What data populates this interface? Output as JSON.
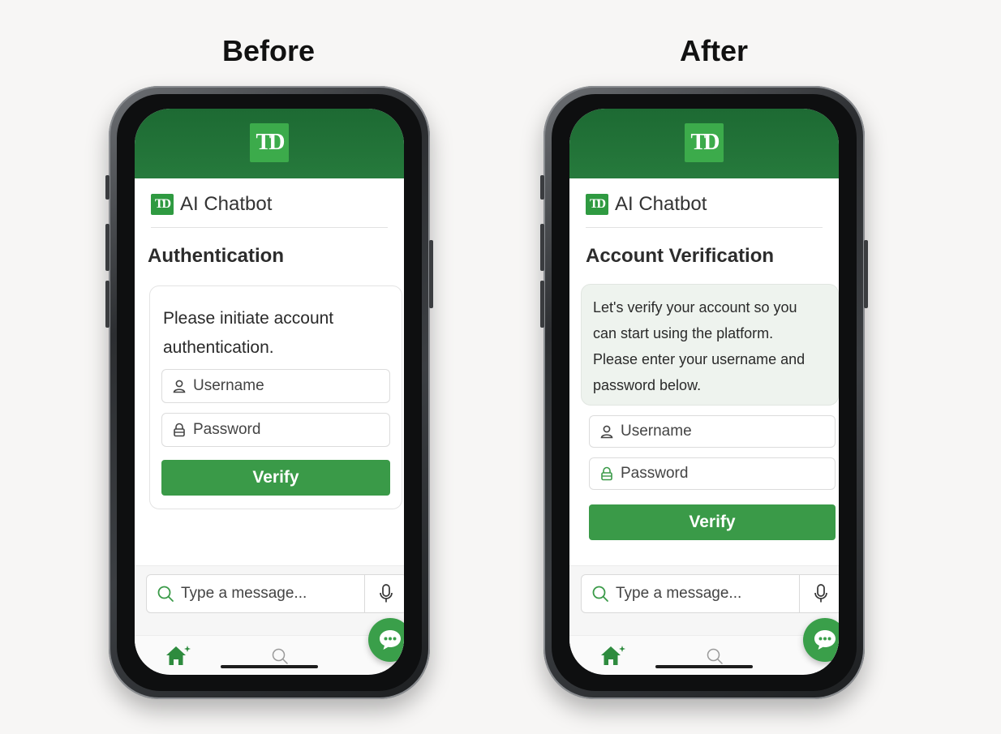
{
  "panels": [
    {
      "label": "Before",
      "header_logo": "TD",
      "brand_logo": "TD",
      "brand_name": "AI Chatbot",
      "section_title": "Authentication",
      "message_lines": [
        "Please initiate account",
        "authentication."
      ],
      "username_placeholder": "Username",
      "password_placeholder": "Password",
      "verify_label": "Verify",
      "compose_placeholder": "Type a message..."
    },
    {
      "label": "After",
      "header_logo": "TD",
      "brand_logo": "TD",
      "brand_name": "AI Chatbot",
      "section_title": "Account Verification",
      "message_lines": [
        "Let's verify your account so you",
        "can start using the platform.",
        "Please enter your username and",
        "password below."
      ],
      "username_placeholder": "Username",
      "password_placeholder": "Password",
      "verify_label": "Verify",
      "compose_placeholder": "Type a message..."
    }
  ],
  "icons": {
    "user": "user-icon",
    "lock": "lock-icon",
    "search": "search-icon",
    "mic": "microphone-icon",
    "home": "home-icon",
    "chat": "chat-bubble-icon"
  },
  "colors": {
    "brand_dark_green": "#1d6a33",
    "brand_green": "#3a9a48",
    "logo_green": "#3cab4b",
    "after_bubble": "#eef3ee"
  }
}
